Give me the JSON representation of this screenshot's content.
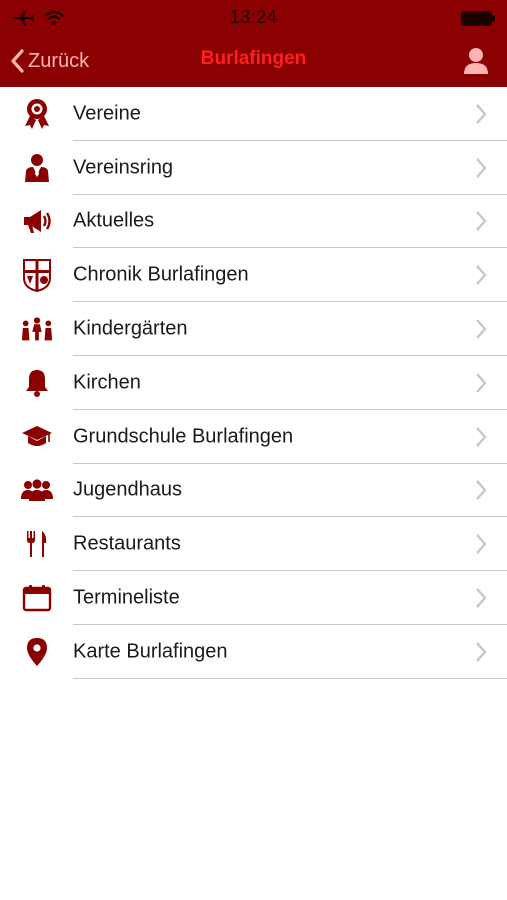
{
  "status": {
    "time": "13:24",
    "icons": [
      "airplane-icon",
      "wifi-icon",
      "battery-icon"
    ]
  },
  "nav": {
    "back_label": "Zurück",
    "title": "Burlafingen",
    "right_icon": "person-icon"
  },
  "colors": {
    "bar_background": "#8b0000",
    "title": "#ff1f1f",
    "icon": "#8b0000",
    "chevron": "#c7c7cc"
  },
  "menu": {
    "items": [
      {
        "label": "Vereine",
        "icon": "award-ribbon-icon"
      },
      {
        "label": "Vereinsring",
        "icon": "person-suit-icon"
      },
      {
        "label": "Aktuelles",
        "icon": "megaphone-icon"
      },
      {
        "label": "Chronik Burlafingen",
        "icon": "coat-of-arms-icon"
      },
      {
        "label": "Kindergärten",
        "icon": "children-icon"
      },
      {
        "label": "Kirchen",
        "icon": "bell-icon"
      },
      {
        "label": "Grundschule Burlafingen",
        "icon": "graduation-cap-icon"
      },
      {
        "label": "Jugendhaus",
        "icon": "group-icon"
      },
      {
        "label": "Restaurants",
        "icon": "cutlery-icon"
      },
      {
        "label": "Termineliste",
        "icon": "calendar-icon"
      },
      {
        "label": "Karte Burlafingen",
        "icon": "map-pin-icon"
      }
    ]
  }
}
